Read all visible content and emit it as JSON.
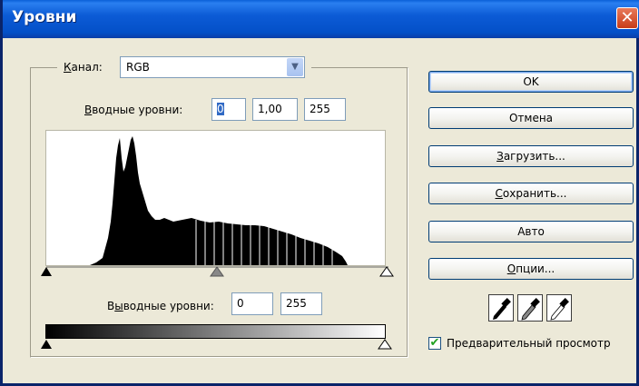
{
  "window": {
    "title": "Уровни",
    "close_glyph": "✕"
  },
  "channel": {
    "label_u": "К",
    "label_rest": "анал:",
    "value": "RGB"
  },
  "input_levels": {
    "label_u": "В",
    "label_rest": "водные уровни:",
    "black": "0",
    "gamma": "1,00",
    "white": "255"
  },
  "output_levels": {
    "label_pre": "В",
    "label_u": "ы",
    "label_rest": "водные уровни:",
    "black": "0",
    "white": "255"
  },
  "buttons": {
    "ok": "OK",
    "cancel": "Отмена",
    "load_u": "З",
    "load_rest": "агрузить...",
    "save_u": "С",
    "save_rest": "охранить...",
    "auto": "Авто",
    "options_u": "О",
    "options_rest": "пции..."
  },
  "eyedroppers": [
    "black-point-eyedropper-icon",
    "gray-point-eyedropper-icon",
    "white-point-eyedropper-icon"
  ],
  "preview": {
    "checked": true,
    "label": "Предварительный просмотр"
  },
  "colors": {
    "title_bar": "#0a5fd8",
    "face": "#ece9d8",
    "close": "#c83c18",
    "check": "#21a121"
  }
}
